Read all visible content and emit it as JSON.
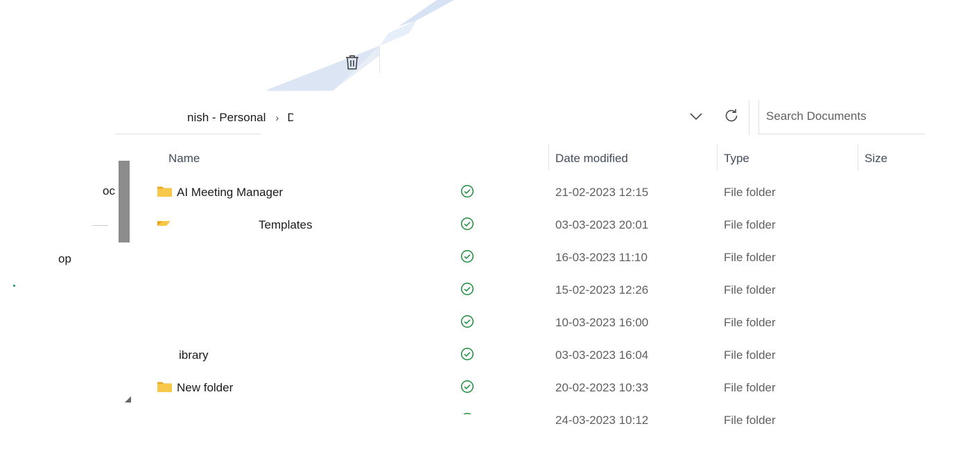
{
  "toolbar": {
    "delete_icon": "trash-icon"
  },
  "address_bar": {
    "breadcrumb": [
      "nish - Personal",
      "D"
    ],
    "separator": "›",
    "chevron_icon": "chevron-down-icon",
    "refresh_icon": "refresh-icon"
  },
  "search": {
    "placeholder": "Search Documents",
    "value": ""
  },
  "nav": {
    "fragment_1": "oc",
    "fragment_2": "op"
  },
  "columns": {
    "name": "Name",
    "date_modified": "Date modified",
    "type": "Type",
    "size": "Size"
  },
  "files": [
    {
      "name": "AI Meeting Manager",
      "date": "21-02-2023 12:15",
      "type": "File folder",
      "status_icon": "synced-check-icon",
      "folder_icon": "folder-icon"
    },
    {
      "name": "Templates",
      "date": "03-03-2023 20:01",
      "type": "File folder",
      "status_icon": "synced-check-icon",
      "folder_icon": "folder-open-icon"
    },
    {
      "name": "",
      "date": "16-03-2023 11:10",
      "type": "File folder",
      "status_icon": "synced-check-icon"
    },
    {
      "name": "",
      "date": "15-02-2023 12:26",
      "type": "File folder",
      "status_icon": "synced-check-icon"
    },
    {
      "name": "",
      "date": "10-03-2023 16:00",
      "type": "File folder",
      "status_icon": "synced-check-icon"
    },
    {
      "name": "ibrary",
      "date": "03-03-2023 16:04",
      "type": "File folder",
      "status_icon": "synced-check-icon"
    },
    {
      "name": "New folder",
      "date": "20-02-2023 10:33",
      "type": "File folder",
      "status_icon": "synced-check-icon",
      "folder_icon": "folder-icon"
    },
    {
      "name": "",
      "date": "24-03-2023 10:12",
      "type": "File folder",
      "status_icon": "synced-check-icon"
    }
  ],
  "colors": {
    "accent": "#0067c0",
    "sync_green": "#1b8f3a",
    "folder_yellow": "#f5c542",
    "muted_text": "#5f5f5f"
  }
}
